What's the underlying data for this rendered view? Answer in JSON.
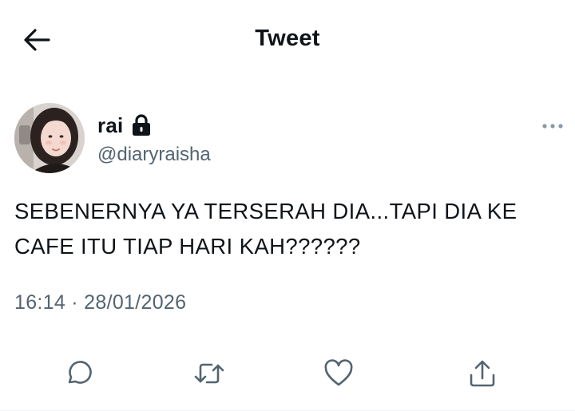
{
  "header": {
    "title": "Tweet",
    "back_icon": "arrow-left-icon"
  },
  "author": {
    "display_name": "rai",
    "handle": "@diaryraisha",
    "protected_icon": "lock-icon",
    "avatar": "avatar-photo"
  },
  "tweet": {
    "text": "SEBENERNYA YA TERSERAH DIA...TAPI DIA KE\nCAFE ITU TIAP HARI KAH??????",
    "timestamp": "16:14 · 28/01/2026",
    "more_icon": "more-horizontal-icon"
  },
  "actions": [
    {
      "name": "reply",
      "icon": "reply-icon"
    },
    {
      "name": "retweet",
      "icon": "retweet-icon"
    },
    {
      "name": "like",
      "icon": "heart-icon"
    },
    {
      "name": "share",
      "icon": "share-icon"
    }
  ],
  "colors": {
    "text_primary": "#0f1419",
    "text_secondary": "#536471",
    "icon": "#536471",
    "background": "#ffffff"
  }
}
